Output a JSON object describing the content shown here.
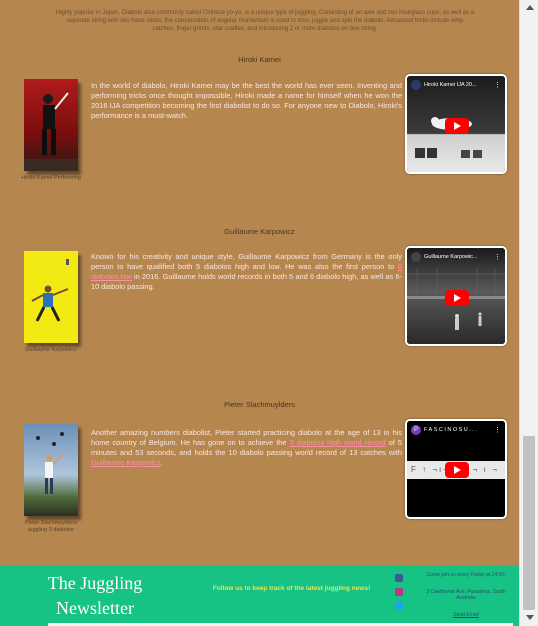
{
  "intro": "Highly popular in Japan, Diabolo also commonly called Chinese yo-yo, is a unique type of juggling. Consisting of an axle and two hourglass cups, as well as a seperate string with two hand sticks, the conservation of angular momentum is used to toss, juggle and spin the diabolo. Advanced tricks include whip catches, finger grinds, star cradles, and introducing 2 or more diabolos on one string.",
  "sections": [
    {
      "title": "Hiroki Kamei",
      "caption": "Hiroki Kamei Performing",
      "text": "In the world of diabolo, Hiroki Kamei may be the best the world has ever seen. Inventing and performing tricks once thought impossible, Hiroki made a name for himself when he won the 2016 IJA competition becoming the first diabolist to do so. For anyone new to Diabolo, Hiroki's performance is a must-watch.",
      "video_title": "Hiroki Kamei IJA 20..."
    },
    {
      "title": "Guillaume Karpowicz",
      "caption": "Guillaume Karpowicz",
      "text_before": "Known for his creativity and unique style, Guillaume Karpowicz from Germany is the only person to have qualified both 5 diabolos high and low. He was also the first person to ",
      "link": "6 diabolos low",
      "text_after": " in 2016. Guillaume holds world records in both 5 and 6 diabolo high, as well as 6-10 diabolo passing.",
      "video_title": "Guillaume Karpowic..."
    },
    {
      "title": "Pieter Slachmuylders",
      "caption": "Pieter Slachmuylders juggling 3 diabolos",
      "text_before": "Another amazing numbers diabolist, Pieter started practicing diabolo at the age of 13 in his home country of Belgium. He has gone on to achieve the ",
      "link1": "3 diabolos high world record",
      "text_middle": " of 5 minutes and 53 seconds, and holds the 10 diabolo passing world record of 13 catches with ",
      "link2": "Guillaume Karpowicz",
      "text_after": ".",
      "video_title": "FASCINOSU...",
      "channel_letter": "P",
      "video_overlay": "F ↑ ¬ı¬   ı ↑ ¬ ı ¬"
    }
  ],
  "footer": {
    "title": "The Juggling Newsletter",
    "follow": "Follow us to keep track of the latest juggling news!",
    "join": "Come join us every Friday at 14:00!",
    "address": "3 Cawthorne Ave, Pasadena, South Australia",
    "email": "Send Email"
  },
  "colors": {
    "page_bg": "#b5874f",
    "footer_bg": "#17c384",
    "link": "#ff8fa6",
    "footer_follow": "#f2e04a"
  },
  "icons": [
    "facebook-icon",
    "instagram-icon",
    "twitter-icon",
    "youtube-play-icon"
  ]
}
